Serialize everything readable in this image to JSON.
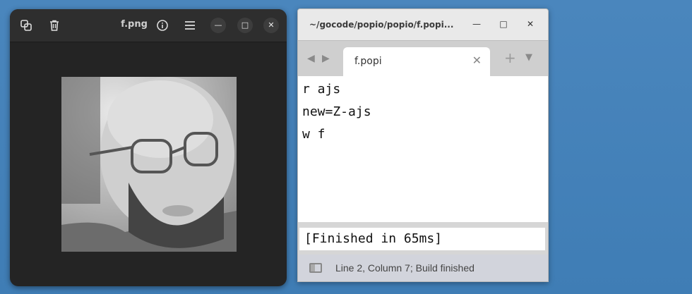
{
  "viewer": {
    "title": "f.png",
    "icons": [
      "copy-icon",
      "trash-icon",
      "info-icon",
      "menu-icon",
      "minimize-icon",
      "maximize-icon",
      "close-icon"
    ]
  },
  "editor": {
    "window_title": "~/gocode/popio/popio/f.popi...",
    "tab_label": "f.popi",
    "lines": [
      "r ajs",
      "new=Z-ajs",
      "w f"
    ],
    "output": "[Finished in 65ms]",
    "status": "Line 2, Column 7; Build finished"
  },
  "desktop": {
    "background_color": "#4581b9"
  }
}
